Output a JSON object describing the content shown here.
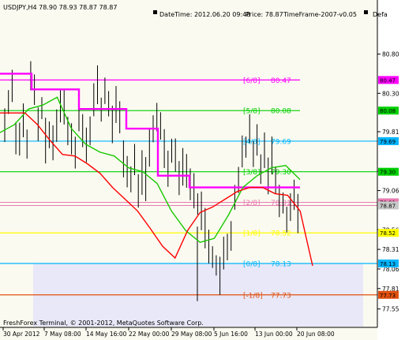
{
  "header": {
    "symbol_line": "USDJPY,H4  78.90 78.93 78.87 78.87",
    "datetime_text": "DateTime: 2012.06.20 09:48",
    "price_text": "Price: 78.87",
    "timeframe_text": "TimeFrame-2007-v0.05",
    "default_text": "Defa"
  },
  "footer": {
    "copyright_text": "FreshForex Terminal, © 2001-2012, MetaQuotes Software Corp."
  },
  "colors": {
    "background": "#fbfaf0",
    "magenta": "#ff00ff",
    "pink": "#e67bb0",
    "green": "#00d000",
    "cyan": "#00b4ff",
    "yellow": "#ffff00",
    "orange_red": "#e05010",
    "candles": "#000000",
    "red_line": "#ff0000",
    "green_line": "#19c800",
    "zone": "#e8e8f8"
  },
  "chart_data": {
    "type": "line",
    "symbol": "USDJPY",
    "timeframe": "H4",
    "x_labels": [
      "30 Apr 2012",
      "7 May 08:00",
      "14 May 16:00",
      "22 May 00:00",
      "29 May 08:00",
      "5 Jun 16:00",
      "13 Jun 00:00",
      "20 Jun 08:00"
    ],
    "y_ticks": [
      "80.80",
      "80.30",
      "79.81",
      "79.31",
      "79.06",
      "78.56",
      "78.31",
      "78.06",
      "77.81",
      "77.55"
    ],
    "price_tags": [
      "80.47",
      "80.08",
      "79.69",
      "79.30",
      "78.91",
      "78.87",
      "78.52",
      "78.13",
      "77.73"
    ],
    "levels": [
      {
        "name": "[6/8]",
        "value": 80.47,
        "label": "80.47",
        "color": "#ff00ff"
      },
      {
        "name": "[5/8]",
        "value": 80.08,
        "label": "80.08",
        "color": "#00d000"
      },
      {
        "name": "[4/8]",
        "value": 79.69,
        "label": "79.69",
        "color": "#00b4ff"
      },
      {
        "name": "[3/8]",
        "value": 79.3,
        "label": "79.30",
        "color": "#00d000"
      },
      {
        "name": "[2/8]",
        "value": 78.91,
        "label": "78.91",
        "color": "#e67bb0"
      },
      {
        "name": "[1/8]",
        "value": 78.52,
        "label": "78.52",
        "color": "#ffff00"
      },
      {
        "name": "[0/8]",
        "value": 78.13,
        "label": "78.13",
        "color": "#00b4ff"
      },
      {
        "name": "[-1/8]",
        "value": 77.73,
        "label": "77.73",
        "color": "#e05010"
      }
    ],
    "ylim": [
      77.5,
      80.85
    ],
    "grid": false,
    "series": [
      {
        "values": [
          80.05,
          80.05,
          80.05,
          79.9,
          79.7,
          79.52,
          79.5,
          79.4,
          79.28,
          79.1,
          78.95,
          78.8,
          78.58,
          78.35,
          78.2,
          78.55,
          78.78,
          78.85,
          78.95,
          79.05,
          79.1,
          79.1,
          79.02,
          79.0,
          78.8,
          78.1
        ]
      },
      {
        "values": [
          79.8,
          79.9,
          80.1,
          80.15,
          80.25,
          79.85,
          79.65,
          79.55,
          79.5,
          79.35,
          79.3,
          79.15,
          78.8,
          78.55,
          78.4,
          78.45,
          78.75,
          79.1,
          79.25,
          79.35,
          79.38,
          79.2
        ]
      },
      {
        "values": [
          80.55,
          80.55,
          80.35,
          80.35,
          80.35,
          80.1,
          80.1,
          80.1,
          79.85,
          79.85,
          79.25,
          79.25,
          79.1,
          79.1,
          79.1,
          79.1,
          79.1,
          79.1,
          79.1,
          79.1
        ]
      }
    ]
  }
}
